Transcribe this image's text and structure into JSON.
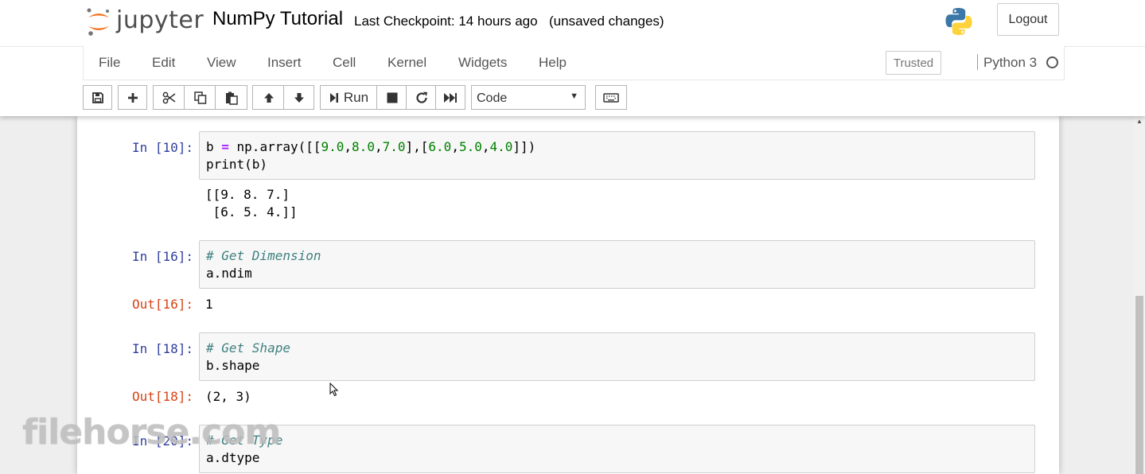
{
  "header": {
    "logo_text": "jupyter",
    "notebook_name": "NumPy Tutorial",
    "checkpoint": "Last Checkpoint: 14 hours ago",
    "autosave": "(unsaved changes)",
    "logout_label": "Logout",
    "python_logo": "python-logo-icon"
  },
  "menubar": {
    "items": [
      "File",
      "Edit",
      "View",
      "Insert",
      "Cell",
      "Kernel",
      "Widgets",
      "Help"
    ],
    "trusted_label": "Trusted",
    "kernel_name": "Python 3"
  },
  "toolbar": {
    "run_label": "Run",
    "cell_type": "Code",
    "icons": [
      "save-icon",
      "plus-icon",
      "cut-icon",
      "copy-icon",
      "paste-icon",
      "arrow-up-icon",
      "arrow-down-icon",
      "run-icon",
      "stop-icon",
      "restart-icon",
      "fast-forward-icon",
      "keyboard-icon"
    ]
  },
  "cells": [
    {
      "in_prompt": "In [10]:",
      "code_lines": [
        "b = np.array([[9.0,8.0,7.0],[6.0,5.0,4.0]])",
        "print(b)"
      ],
      "stdout_lines": [
        "[[9. 8. 7.]",
        " [6. 5. 4.]]"
      ]
    },
    {
      "in_prompt": "In [16]:",
      "code_lines": [
        "# Get Dimension",
        "a.ndim"
      ],
      "out_prompt": "Out[16]:",
      "result": "1"
    },
    {
      "in_prompt": "In [18]:",
      "code_lines": [
        "# Get Shape",
        "b.shape"
      ],
      "out_prompt": "Out[18]:",
      "result": "(2, 3)"
    },
    {
      "in_prompt": "In [20]:",
      "code_lines": [
        "# Get Type",
        "a.dtype"
      ]
    }
  ],
  "watermark": "filehorse.com",
  "colors": {
    "in_prompt": "#303f9f",
    "out_prompt": "#d84315",
    "comment": "#408080",
    "number": "#008000",
    "operator": "#aa22ff"
  }
}
